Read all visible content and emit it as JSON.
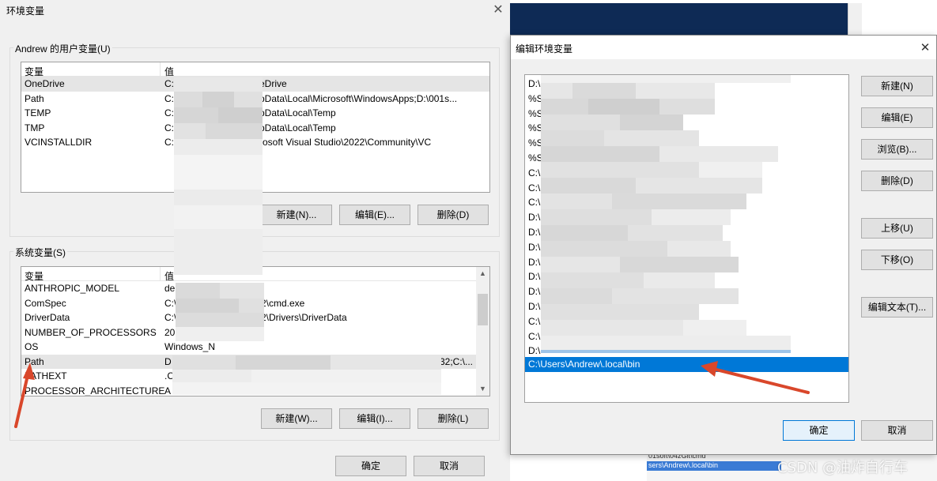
{
  "env_dialog": {
    "title": "环境变量",
    "close": "✕",
    "user_section": {
      "title": "Andrew 的用户变量(U)",
      "col_var": "变量",
      "col_val": "值",
      "rows": [
        {
          "name": "OneDrive",
          "value": "C:\\",
          "value_tail": "eDrive"
        },
        {
          "name": "Path",
          "value": "C:\\",
          "value_tail": "pData\\Local\\Microsoft\\WindowsApps;D:\\001s..."
        },
        {
          "name": "TEMP",
          "value": "C:\\",
          "value_tail": "pData\\Local\\Temp"
        },
        {
          "name": "TMP",
          "value": "C:\\",
          "value_tail": "pData\\Local\\Temp"
        },
        {
          "name": "VCINSTALLDIR",
          "value": "C:\\",
          "value_tail": "rosoft Visual Studio\\2022\\Community\\VC"
        }
      ],
      "btn_new": "新建(N)...",
      "btn_edit": "编辑(E)...",
      "btn_delete": "删除(D)"
    },
    "system_section": {
      "title": "系统变量(S)",
      "col_var": "变量",
      "col_val": "值",
      "rows": [
        {
          "name": "ANTHROPIC_MODEL",
          "value": "de",
          "value_tail": "]"
        },
        {
          "name": "ComSpec",
          "value": "C:\\",
          "value_tail": "2\\cmd.exe"
        },
        {
          "name": "DriverData",
          "value": "C:\\",
          "value_tail": "2\\Drivers\\DriverData"
        },
        {
          "name": "NUMBER_OF_PROCESSORS",
          "value": "20",
          "value_tail": ""
        },
        {
          "name": "OS",
          "value": "Windows_N",
          "value_tail": ""
        },
        {
          "name": "Path",
          "value": "D",
          "value_tail": "32;C:\\..."
        },
        {
          "name": "PATHEXT",
          "value": ".C",
          "value_tail": ""
        },
        {
          "name": "PROCESSOR_ARCHITECTURE",
          "value": "A",
          "value_tail": ""
        }
      ],
      "btn_new": "新建(W)...",
      "btn_edit": "编辑(I)...",
      "btn_delete": "删除(L)"
    },
    "btn_ok": "确定",
    "btn_cancel": "取消"
  },
  "edit_dialog": {
    "title": "编辑环境变量",
    "close": "✕",
    "entries": [
      "D:\\",
      "%S",
      "%S",
      "%S",
      "%S",
      "%S",
      "C:\\",
      "C:\\",
      "C:\\",
      "D:\\",
      "D:\\",
      "D:\\",
      "D:\\",
      "D:\\",
      "D:\\",
      "D:\\",
      "C:\\",
      "C:\\",
      "D:\\"
    ],
    "selected_entry": "C:\\Users\\Andrew\\.local\\bin",
    "btn_new": "新建(N)",
    "btn_edit": "编辑(E)",
    "btn_browse": "浏览(B)...",
    "btn_delete": "删除(D)",
    "btn_up": "上移(U)",
    "btn_down": "下移(O)",
    "btn_edit_text": "编辑文本(T)...",
    "btn_ok": "确定",
    "btn_cancel": "取消"
  },
  "background": {
    "line1": "01soft\\04zGit\\cmd",
    "line2": "sers\\Andrew\\.local\\bin"
  },
  "watermark": "CSDN @油炸自行车",
  "colors": {
    "selection": "#0078d7",
    "arrow": "#d9472b",
    "dialog_bg": "#f0f0f0"
  }
}
